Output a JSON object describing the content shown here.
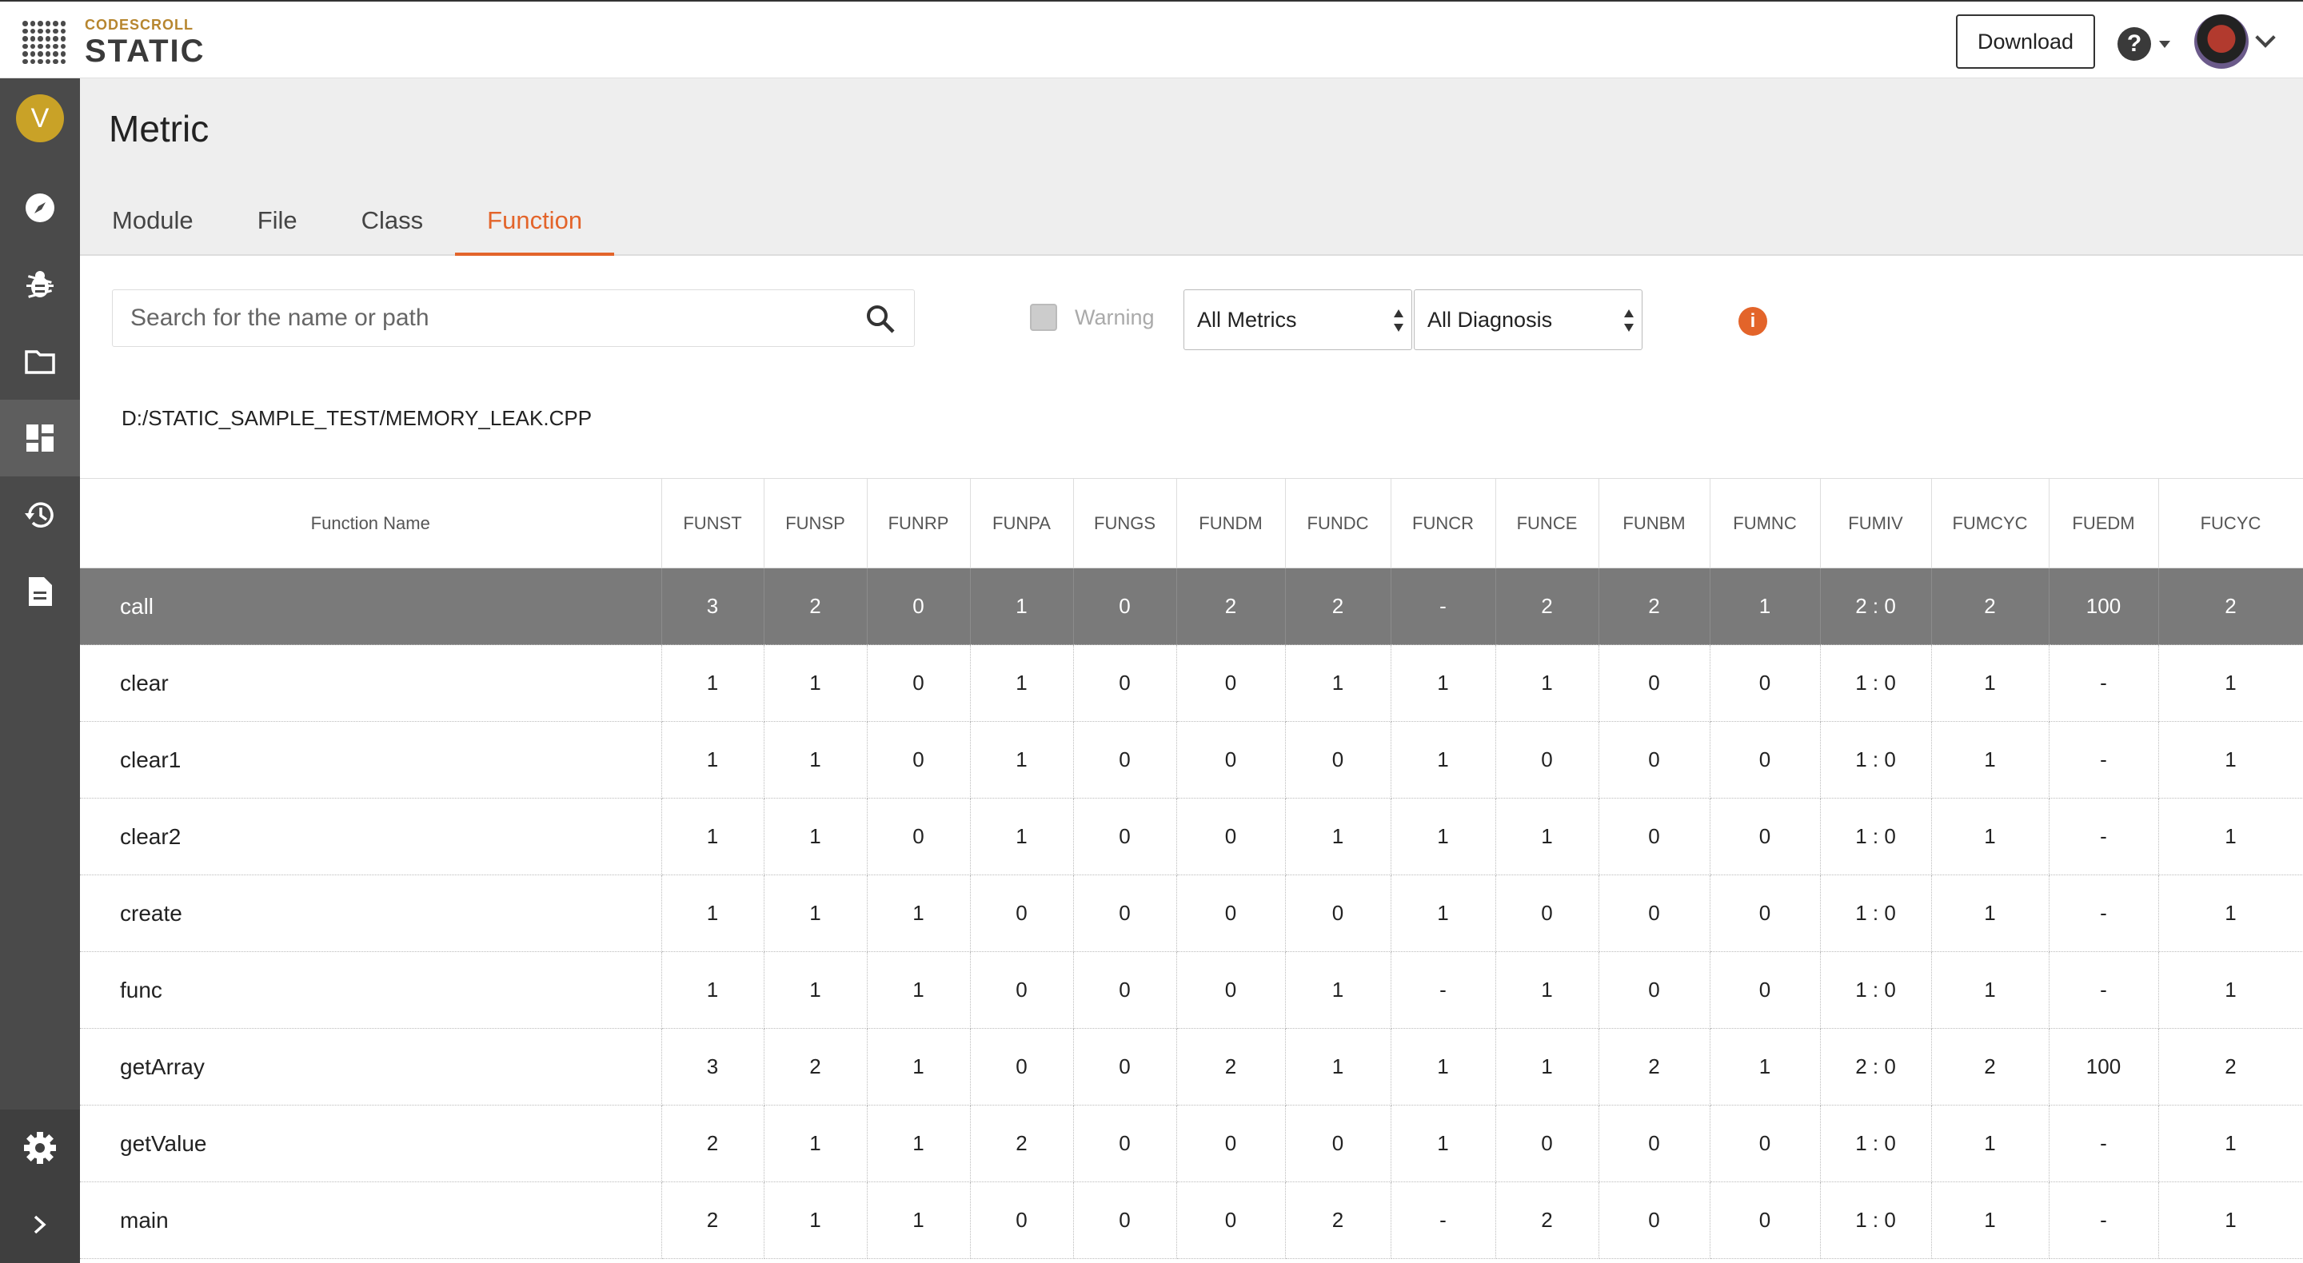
{
  "app": {
    "logo_top": "CODESCROLL",
    "logo_bottom": "STATIC",
    "download_label": "Download",
    "help_label": "?",
    "accent_color": "#e3642a"
  },
  "sidebar": {
    "user_initial": "V",
    "items": [
      {
        "name": "compass-icon"
      },
      {
        "name": "bug-icon"
      },
      {
        "name": "folder-icon"
      },
      {
        "name": "dashboard-icon",
        "active": true
      },
      {
        "name": "history-icon"
      },
      {
        "name": "document-icon"
      }
    ],
    "bottom": [
      {
        "name": "gear-icon"
      },
      {
        "name": "chevron-right-icon"
      }
    ]
  },
  "page": {
    "title": "Metric",
    "tabs": [
      "Module",
      "File",
      "Class",
      "Function"
    ],
    "active_tab": "Function"
  },
  "toolbar": {
    "search_placeholder": "Search for the name or path",
    "warning_label": "Warning",
    "metrics_select": "All Metrics",
    "diagnosis_select": "All Diagnosis"
  },
  "file_path": "D:/STATIC_SAMPLE_TEST/MEMORY_LEAK.CPP",
  "table": {
    "columns": [
      "Function Name",
      "FUNST",
      "FUNSP",
      "FUNRP",
      "FUNPA",
      "FUNGS",
      "FUNDM",
      "FUNDC",
      "FUNCR",
      "FUNCE",
      "FUNBM",
      "FUMNC",
      "FUMIV",
      "FUMCYC",
      "FUEDM",
      "FUCYC"
    ],
    "rows": [
      {
        "name": "call",
        "selected": true,
        "values": [
          "3",
          "2",
          "0",
          "1",
          "0",
          "2",
          "2",
          "-",
          "2",
          "2",
          "1",
          "2 : 0",
          "2",
          "100",
          "2"
        ]
      },
      {
        "name": "clear",
        "values": [
          "1",
          "1",
          "0",
          "1",
          "0",
          "0",
          "1",
          "1",
          "1",
          "0",
          "0",
          "1 : 0",
          "1",
          "-",
          "1"
        ]
      },
      {
        "name": "clear1",
        "values": [
          "1",
          "1",
          "0",
          "1",
          "0",
          "0",
          "0",
          "1",
          "0",
          "0",
          "0",
          "1 : 0",
          "1",
          "-",
          "1"
        ]
      },
      {
        "name": "clear2",
        "values": [
          "1",
          "1",
          "0",
          "1",
          "0",
          "0",
          "1",
          "1",
          "1",
          "0",
          "0",
          "1 : 0",
          "1",
          "-",
          "1"
        ]
      },
      {
        "name": "create",
        "values": [
          "1",
          "1",
          "1",
          "0",
          "0",
          "0",
          "0",
          "1",
          "0",
          "0",
          "0",
          "1 : 0",
          "1",
          "-",
          "1"
        ]
      },
      {
        "name": "func",
        "values": [
          "1",
          "1",
          "1",
          "0",
          "0",
          "0",
          "1",
          "-",
          "1",
          "0",
          "0",
          "1 : 0",
          "1",
          "-",
          "1"
        ]
      },
      {
        "name": "getArray",
        "values": [
          "3",
          "2",
          "1",
          "0",
          "0",
          "2",
          "1",
          "1",
          "1",
          "2",
          "1",
          "2 : 0",
          "2",
          "100",
          "2"
        ]
      },
      {
        "name": "getValue",
        "values": [
          "2",
          "1",
          "1",
          "2",
          "0",
          "0",
          "0",
          "1",
          "0",
          "0",
          "0",
          "1 : 0",
          "1",
          "-",
          "1"
        ]
      },
      {
        "name": "main",
        "values": [
          "2",
          "1",
          "1",
          "0",
          "0",
          "0",
          "2",
          "-",
          "2",
          "0",
          "0",
          "1 : 0",
          "1",
          "-",
          "1"
        ]
      }
    ]
  }
}
